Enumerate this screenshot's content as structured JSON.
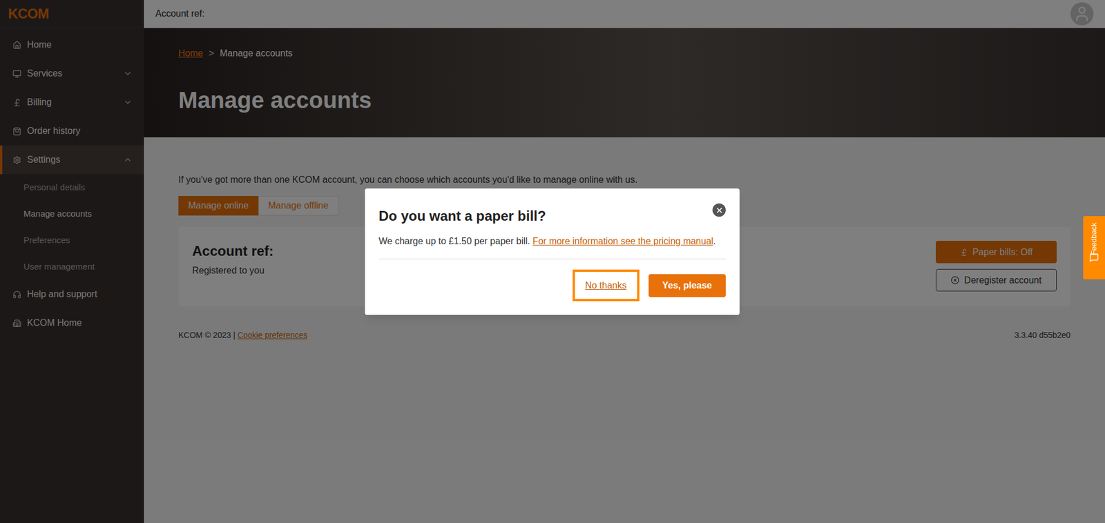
{
  "logo": "KCOM",
  "topbar": {
    "account_ref": "Account ref:"
  },
  "sidebar": {
    "items": [
      {
        "label": "Home",
        "expandable": false,
        "expanded": false,
        "selected": false,
        "children": []
      },
      {
        "label": "Services",
        "expandable": true,
        "expanded": false,
        "selected": false,
        "children": []
      },
      {
        "label": "Billing",
        "expandable": true,
        "expanded": false,
        "selected": false,
        "children": []
      },
      {
        "label": "Order history",
        "expandable": false,
        "expanded": false,
        "selected": false,
        "children": []
      },
      {
        "label": "Settings",
        "expandable": true,
        "expanded": true,
        "selected": true,
        "children": [
          {
            "label": "Personal details",
            "selected": false
          },
          {
            "label": "Manage accounts",
            "selected": true
          },
          {
            "label": "Preferences",
            "selected": false
          },
          {
            "label": "User management",
            "selected": false
          }
        ]
      },
      {
        "label": "Help and support",
        "expandable": false,
        "expanded": false,
        "selected": false,
        "children": []
      },
      {
        "label": "KCOM Home",
        "expandable": false,
        "expanded": false,
        "selected": false,
        "children": []
      }
    ]
  },
  "breadcrumb": {
    "separator": ">",
    "items": [
      {
        "label": "Home",
        "link": true
      },
      {
        "label": "Manage accounts",
        "link": false
      }
    ]
  },
  "page_title": "Manage accounts",
  "intro": "If you've got more than one KCOM account, you can choose which accounts you'd like to manage online with us.",
  "tabs": [
    {
      "label": "Manage online",
      "selected": true
    },
    {
      "label": "Manage offline",
      "selected": false
    }
  ],
  "account_card": {
    "title": "Account ref:",
    "subtitle": "Registered to you",
    "buttons": [
      "Paper bills: Off",
      "Deregister account"
    ]
  },
  "footer": {
    "copyright": "KCOM © 2023 |",
    "link": "Cookie preferences",
    "version": "3.3.40 d55b2e0"
  },
  "feedback": "Feedback",
  "modal": {
    "title": "Do you want a paper bill?",
    "text": "We charge up to £1.50 per paper bill.",
    "link": "For more information see the pricing manual",
    "link_suffix": ".",
    "buttons": [
      {
        "label": "No thanks",
        "kind": "link",
        "focused": true
      },
      {
        "label": "Yes, please",
        "kind": "primary",
        "focused": false
      }
    ]
  }
}
